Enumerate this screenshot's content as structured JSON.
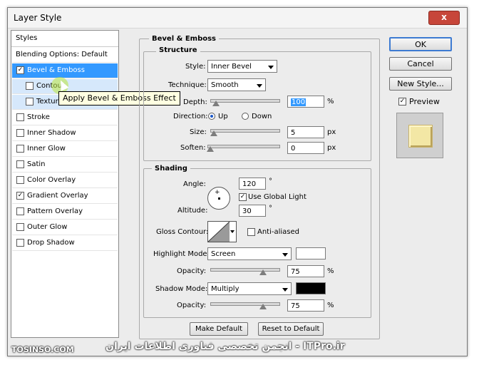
{
  "window": {
    "title": "Layer Style",
    "close_label": "x"
  },
  "styles_panel": {
    "header": "Styles",
    "blending_options": "Blending Options: Default",
    "items": [
      {
        "label": "Bevel & Emboss",
        "checked": "✓"
      },
      {
        "label": "Contour",
        "checked": ""
      },
      {
        "label": "Texture",
        "checked": ""
      },
      {
        "label": "Stroke",
        "checked": ""
      },
      {
        "label": "Inner Shadow",
        "checked": ""
      },
      {
        "label": "Inner Glow",
        "checked": ""
      },
      {
        "label": "Satin",
        "checked": ""
      },
      {
        "label": "Color Overlay",
        "checked": ""
      },
      {
        "label": "Gradient Overlay",
        "checked": "✓"
      },
      {
        "label": "Pattern Overlay",
        "checked": ""
      },
      {
        "label": "Outer Glow",
        "checked": ""
      },
      {
        "label": "Drop Shadow",
        "checked": ""
      }
    ]
  },
  "tooltip": "Apply Bevel & Emboss Effect",
  "bevel_emboss": {
    "title": "Bevel & Emboss",
    "structure": {
      "title": "Structure",
      "style_label": "Style:",
      "style_value": "Inner Bevel",
      "technique_label": "Technique:",
      "technique_value": "Smooth",
      "depth_label": "Depth:",
      "depth_value": "100",
      "depth_unit": "%",
      "direction_label": "Direction:",
      "direction_up": "Up",
      "direction_down": "Down",
      "size_label": "Size:",
      "size_value": "5",
      "size_unit": "px",
      "soften_label": "Soften:",
      "soften_value": "0",
      "soften_unit": "px"
    },
    "shading": {
      "title": "Shading",
      "angle_label": "Angle:",
      "angle_value": "120",
      "angle_unit": "°",
      "use_global_light": "Use Global Light",
      "use_global_light_checked": "✓",
      "altitude_label": "Altitude:",
      "altitude_value": "30",
      "altitude_unit": "°",
      "gloss_contour_label": "Gloss Contour:",
      "anti_aliased": "Anti-aliased",
      "highlight_mode_label": "Highlight Mode:",
      "highlight_mode_value": "Screen",
      "highlight_color": "#ffffff",
      "highlight_opacity_label": "Opacity:",
      "highlight_opacity_value": "75",
      "highlight_opacity_unit": "%",
      "shadow_mode_label": "Shadow Mode:",
      "shadow_mode_value": "Multiply",
      "shadow_color": "#000000",
      "shadow_opacity_label": "Opacity:",
      "shadow_opacity_value": "75",
      "shadow_opacity_unit": "%"
    },
    "make_default": "Make Default",
    "reset_to_default": "Reset to Default"
  },
  "buttons": {
    "ok": "OK",
    "cancel": "Cancel",
    "new_style": "New Style...",
    "preview": "Preview",
    "preview_checked": "✓"
  },
  "watermark": {
    "left": "TOSINSO.COM",
    "right": "انجمن تخصصی فناوری اطلاعات ایران - ITPro.ir"
  }
}
